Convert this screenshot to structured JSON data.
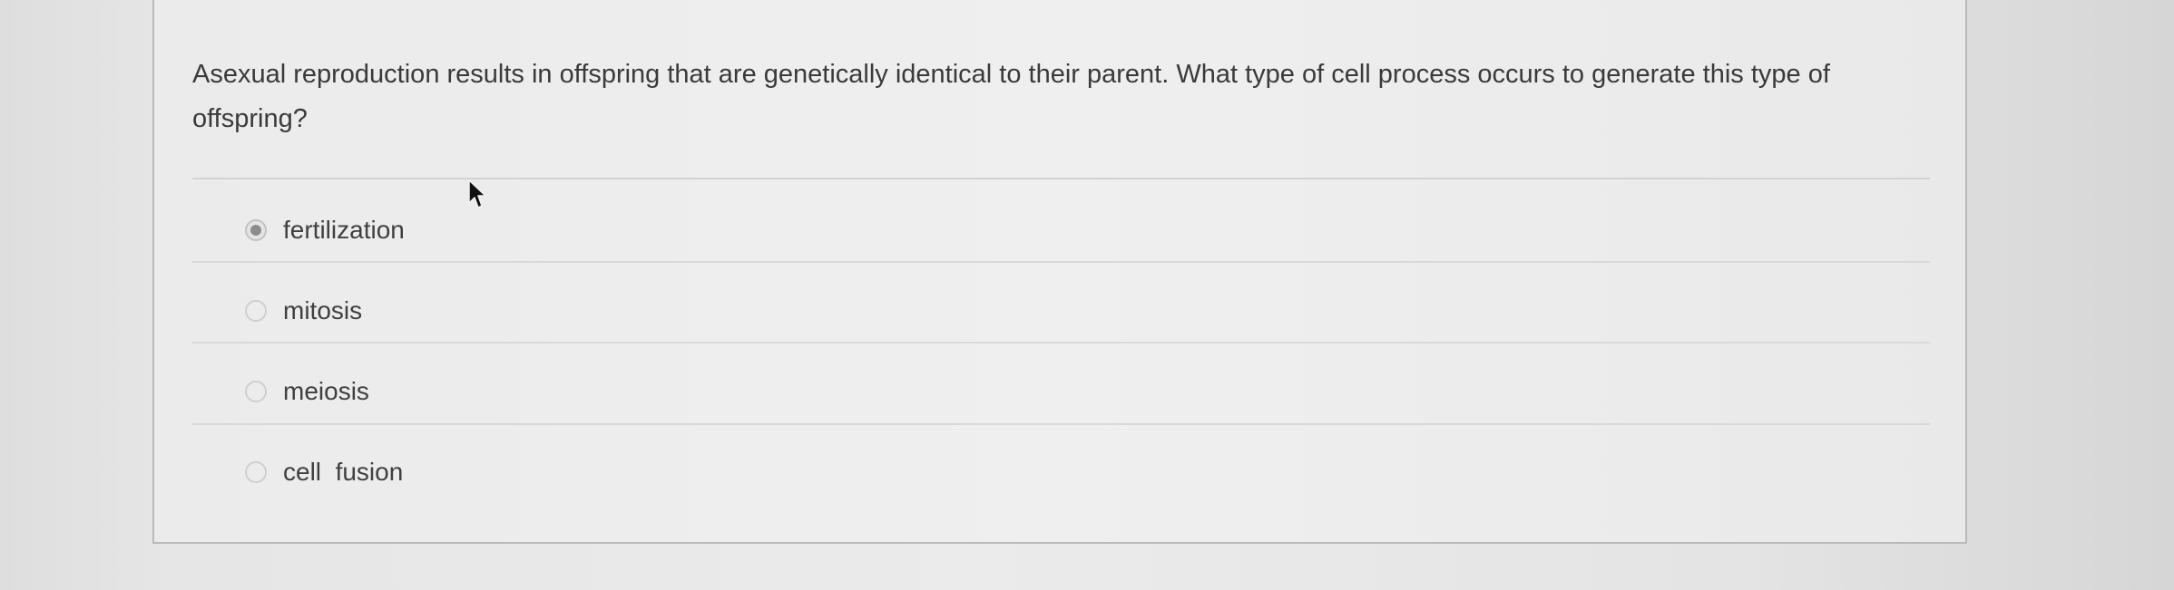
{
  "question": {
    "text": "Asexual reproduction results in offspring that are genetically identical to their parent. What type of cell process occurs to generate this type of offspring?"
  },
  "options": [
    {
      "label": "fertilization",
      "selected": true
    },
    {
      "label": "mitosis",
      "selected": false
    },
    {
      "label": "meiosis",
      "selected": false
    },
    {
      "label": "cell  fusion",
      "selected": false
    }
  ],
  "icons": {
    "cursor": "mouse-pointer-icon",
    "radio": "radio-button-icon"
  },
  "colors": {
    "page_background": "#e6e6e6",
    "card_background": "#eeeeee",
    "card_border": "#b9b9b9",
    "text": "#3a3a3a",
    "selected_radio_dot": "#8c8c8c"
  }
}
